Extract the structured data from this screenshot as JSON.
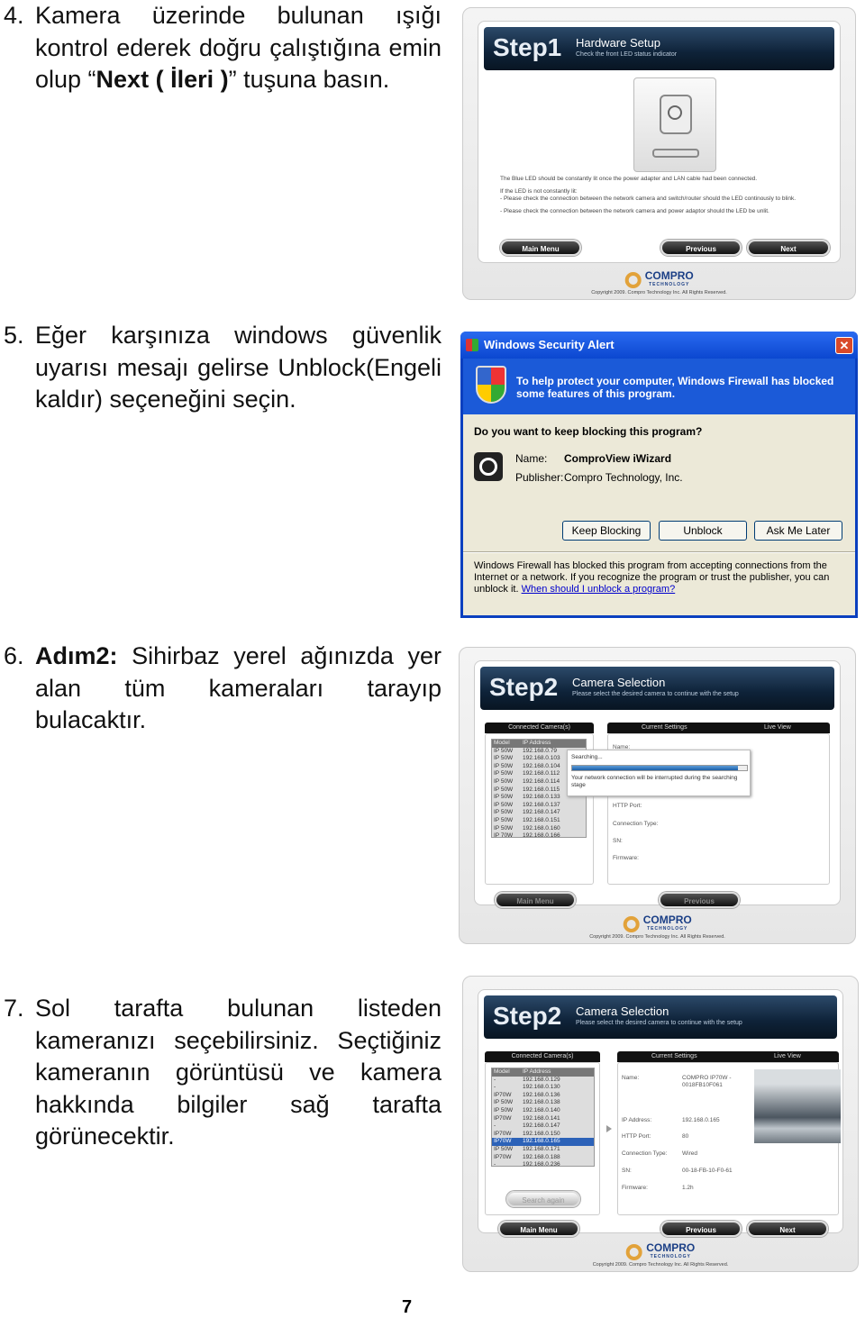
{
  "steps": [
    {
      "num": "4.",
      "text_a": "Kamera üzerinde bulunan ışığı kontrol ederek doğru çalıştığına emin olup “",
      "bold": "Next ( İleri )",
      "text_b": "” tuşuna basın."
    },
    {
      "num": "5.",
      "text_a": "Eğer karşınıza windows güvenlik uyarısı mesajı gelirse Unblock(Engeli kaldır) seçeneğini seçin.",
      "bold": "",
      "text_b": ""
    },
    {
      "num": "6.",
      "text_a": "",
      "bold": "Adım2:",
      "text_b": " Sihirbaz yerel ağınızda yer alan tüm kameraları tarayıp bulacaktır."
    },
    {
      "num": "7.",
      "text_a": "Sol tarafta bulunan listeden kameranızı seçebilirsiniz. Seçtiğiniz kameranın görüntüsü ve kamera hakkında bilgiler sağ tarafta görünecektir.",
      "bold": "",
      "text_b": ""
    }
  ],
  "wizard1": {
    "step": "Step1",
    "title": "Hardware Setup",
    "subtitle": "Check the front LED status indicator",
    "line1": "The Blue LED should be constantly lit once the power adapter and LAN cable had been connected.",
    "line2": "If the LED is not constantly lit:",
    "line3": "- Please check the connection between the network camera and switch/router should the LED continously to blink.",
    "line4": "- Please check the connection between the network camera and power adaptor should the LED be unlit.",
    "main_menu": "Main Menu",
    "previous": "Previous",
    "next": "Next"
  },
  "logo": {
    "name": "COMPRO",
    "tag": "TECHNOLOGY",
    "copyright": "Copyright 2009. Compro Technology Inc. All Rights Reserved."
  },
  "alert": {
    "title": "Windows Security Alert",
    "close": "✕",
    "banner": "To help protect your computer,  Windows Firewall has blocked some features of this program.",
    "question": "Do you want to keep blocking this program?",
    "name_label": "Name:",
    "name": "ComproView iWizard",
    "publisher_label": "Publisher:",
    "publisher": "Compro Technology, Inc.",
    "keep": "Keep Blocking",
    "unblock": "Unblock",
    "later": "Ask Me Later",
    "footer": "Windows Firewall has blocked this program from accepting connections from the Internet or a network. If you recognize the program or trust the publisher, you can unblock it.",
    "link": "When should I unblock a program?"
  },
  "wizard2": {
    "step": "Step2",
    "title": "Camera Selection",
    "subtitle": "Please select the desired camera to continue with the setup",
    "connected": "Connected Camera(s)",
    "current": "Current Settings",
    "live": "Live View",
    "col_model": "Model",
    "col_ip": "IP Address",
    "rows": [
      [
        "IP 50W",
        "192.168.0.79"
      ],
      [
        "IP 50W",
        "192.168.0.103"
      ],
      [
        "IP 50W",
        "192.168.0.104"
      ],
      [
        "IP 50W",
        "192.168.0.112"
      ],
      [
        "IP 50W",
        "192.168.0.114"
      ],
      [
        "IP 50W",
        "192.168.0.115"
      ],
      [
        "IP 50W",
        "192.168.0.133"
      ],
      [
        "IP 50W",
        "192.168.0.137"
      ],
      [
        "IP 50W",
        "192.168.0.147"
      ],
      [
        "IP 50W",
        "192.168.0.151"
      ],
      [
        "IP 50W",
        "192.168.0.160"
      ],
      [
        "IP 70W",
        "192.168.0.166"
      ]
    ],
    "searching": "Searching...",
    "search_progress": 0.95,
    "warning": "Your network connection will be interrupted during the searching stage",
    "name": "Name:",
    "http": "HTTP Port:",
    "conn": "Connection Type:",
    "sn": "SN:",
    "fw": "Firmware:",
    "main_menu": "Main Menu",
    "previous": "Previous"
  },
  "wizard3": {
    "step": "Step2",
    "title": "Camera Selection",
    "subtitle": "Please select the desired camera to continue with the setup",
    "connected": "Connected Camera(s)",
    "current": "Current Settings",
    "live": "Live View",
    "col_model": "Model",
    "col_ip": "IP Address",
    "rows": [
      [
        "-",
        "192.168.0.129"
      ],
      [
        "-",
        "192.168.0.130"
      ],
      [
        "IP70W",
        "192.168.0.136"
      ],
      [
        "IP 50W",
        "192.168.0.138"
      ],
      [
        "IP 50W",
        "192.168.0.140"
      ],
      [
        "IP70W",
        "192.168.0.141"
      ],
      [
        "-",
        "192.168.0.147"
      ],
      [
        "IP70W",
        "192.168.0.150"
      ],
      [
        "IP70W",
        "192.168.0.165"
      ],
      [
        "IP 50W",
        "192.168.0.171"
      ],
      [
        "IP70W",
        "192.168.0.188"
      ],
      [
        "-",
        "192.168.0.236"
      ]
    ],
    "selected_index": 8,
    "search_again": "Search again",
    "name_label": "Name:",
    "name": "COMPRO IP70W - 0018FB10F061",
    "ip_label": "IP Address:",
    "ip": "192.168.0.165",
    "http_label": "HTTP Port:",
    "http": "80",
    "conn_label": "Connection Type:",
    "conn": "Wired",
    "sn_label": "SN:",
    "sn": "00-18-FB-10-F0-61",
    "fw_label": "Firmware:",
    "fw": "1.2h",
    "main_menu": "Main Menu",
    "previous": "Previous",
    "next": "Next"
  },
  "page_number": "7"
}
